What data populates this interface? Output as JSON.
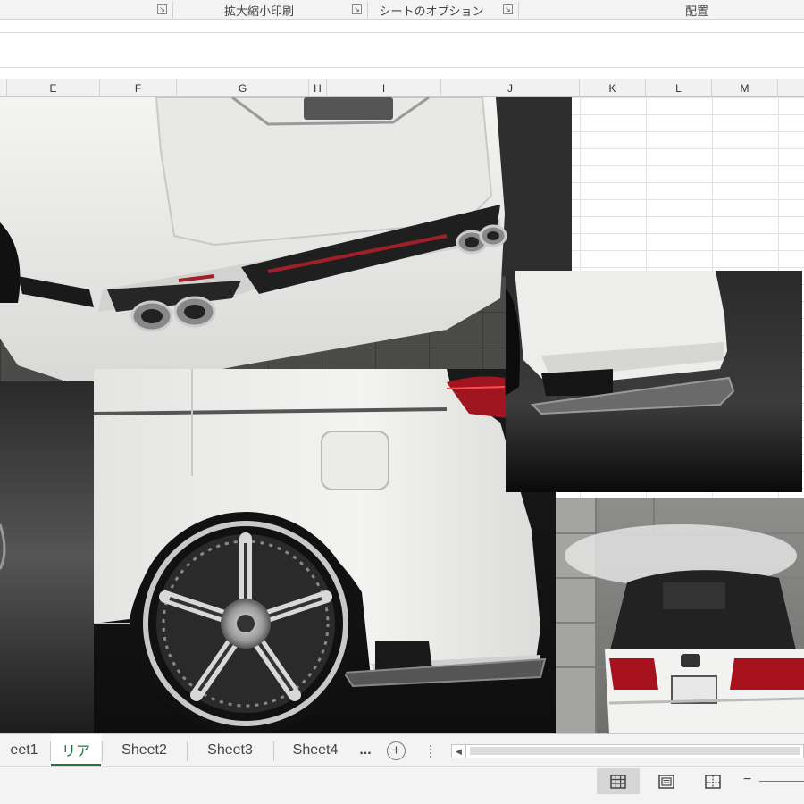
{
  "ribbon": {
    "groups": [
      "拡大縮小印刷",
      "シートのオプション",
      "配置"
    ],
    "launcher_glyph": "↘"
  },
  "columns": [
    "E",
    "F",
    "G",
    "H",
    "I",
    "J",
    "K",
    "L",
    "M"
  ],
  "sheet_tabs": {
    "tabs": [
      "eet1",
      "リア",
      "Sheet2",
      "Sheet3",
      "Sheet4"
    ],
    "active_index": 1,
    "more": "...",
    "add_glyph": "+",
    "scroll_left": "◀"
  },
  "status_bar": {
    "zoom_minus": "−"
  },
  "colors": {
    "excel_green": "#217346",
    "car_white": "#eeeeec",
    "dark_bg": "#1a1a1a"
  }
}
